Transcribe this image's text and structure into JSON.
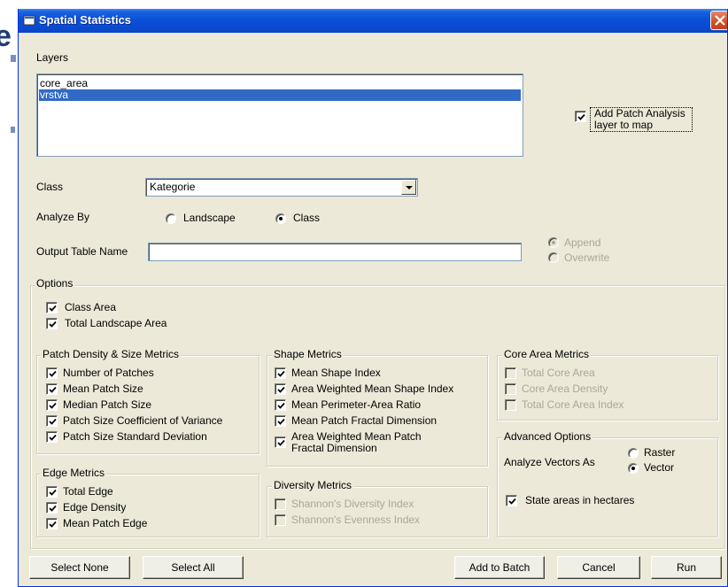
{
  "background": {
    "fragment": "e"
  },
  "window": {
    "title": "Spatial Statistics"
  },
  "layers": {
    "label": "Layers",
    "items": [
      {
        "label": "core_area"
      },
      {
        "label": "vrstva"
      }
    ],
    "selected": "vrstva"
  },
  "add_patch": {
    "label_line1": "Add Patch Analysis",
    "label_line2": "layer to map",
    "checked": true
  },
  "class": {
    "label": "Class",
    "value": "Kategorie"
  },
  "analyze_by": {
    "label": "Analyze By",
    "landscape": "Landscape",
    "class": "Class",
    "selected": "Class"
  },
  "output": {
    "label": "Output Table Name",
    "value": "",
    "append": "Append",
    "overwrite": "Overwrite",
    "selected": "Append"
  },
  "options": {
    "title": "Options",
    "class_area": "Class Area",
    "total_landscape_area": "Total Landscape Area"
  },
  "patch_density": {
    "title": "Patch Density & Size Metrics",
    "items": [
      {
        "label": "Number of Patches",
        "checked": true
      },
      {
        "label": "Mean Patch Size",
        "checked": true
      },
      {
        "label": "Median Patch Size",
        "checked": true
      },
      {
        "label": "Patch Size Coefficient of Variance",
        "checked": true
      },
      {
        "label": "Patch Size Standard Deviation",
        "checked": true
      }
    ]
  },
  "shape": {
    "title": "Shape Metrics",
    "items": [
      {
        "label": "Mean Shape Index",
        "checked": true
      },
      {
        "label": "Area Weighted Mean Shape Index",
        "checked": true
      },
      {
        "label": "Mean Perimeter-Area Ratio",
        "checked": true
      },
      {
        "label": "Mean Patch Fractal Dimension",
        "checked": true
      }
    ],
    "awmpfd_line1": "Area Weighted Mean Patch",
    "awmpfd_line2": "Fractal Dimension"
  },
  "core": {
    "title": "Core Area Metrics",
    "items": [
      {
        "label": "Total Core Area",
        "checked": false
      },
      {
        "label": "Core Area Density",
        "checked": false
      },
      {
        "label": "Total Core Area Index",
        "checked": false
      }
    ]
  },
  "edge": {
    "title": "Edge Metrics",
    "items": [
      {
        "label": "Total Edge",
        "checked": true
      },
      {
        "label": "Edge Density",
        "checked": true
      },
      {
        "label": "Mean Patch Edge",
        "checked": true
      }
    ]
  },
  "diversity": {
    "title": "Diversity Metrics",
    "items": [
      {
        "label": "Shannon's Diversity Index",
        "checked": false
      },
      {
        "label": "Shannon's Evenness Index",
        "checked": false
      }
    ]
  },
  "advanced": {
    "title": "Advanced Options",
    "analyze_vectors": "Analyze Vectors As",
    "raster": "Raster",
    "vector": "Vector",
    "selected": "Vector",
    "hectares": "State areas in hectares",
    "hectares_checked": true
  },
  "buttons": {
    "select_none": "Select None",
    "select_all": "Select All",
    "add_to_batch": "Add to Batch",
    "cancel": "Cancel",
    "run": "Run"
  },
  "colors": {
    "title_bar": "#0a4fd8",
    "dialog_bg": "#ece9d8",
    "selection": "#316ac5",
    "close": "#d04f24"
  }
}
